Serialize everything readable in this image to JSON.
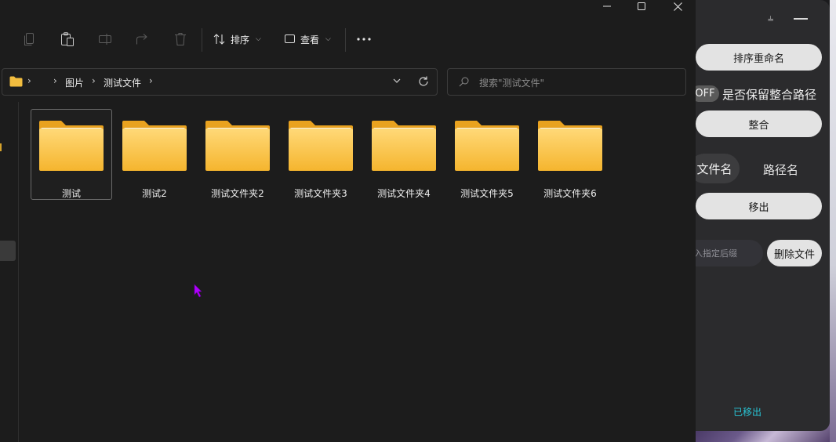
{
  "window": {
    "minimize_icon": "minimize-icon",
    "maximize_icon": "maximize-icon",
    "close_icon": "close-icon"
  },
  "toolbar": {
    "icons": [
      "copy-icon",
      "paste-icon",
      "rename-icon",
      "share-icon",
      "delete-icon"
    ],
    "sort_label": "排序",
    "view_label": "查看",
    "more_icon": "more-icon"
  },
  "address": {
    "crumbs": [
      "图片",
      "测试文件"
    ]
  },
  "search": {
    "placeholder": "搜索\"测试文件\""
  },
  "folders": [
    {
      "name": "测试",
      "selected": true
    },
    {
      "name": "测试2",
      "selected": false
    },
    {
      "name": "测试文件夹2",
      "selected": false
    },
    {
      "name": "测试文件夹3",
      "selected": false
    },
    {
      "name": "测试文件夹4",
      "selected": false
    },
    {
      "name": "测试文件夹5",
      "selected": false
    },
    {
      "name": "测试文件夹6",
      "selected": false
    }
  ],
  "panel": {
    "sort_rename_label": "排序重命名",
    "toggle_label": "OFF",
    "keep_path_label": "是否保留整合路径",
    "merge_label": "整合",
    "seg_filename": "文件名",
    "seg_pathname": "路径名",
    "move_out_label": "移出",
    "suffix_placeholder": "入指定后缀",
    "delete_file_label": "删除文件",
    "status_text": "已移出"
  },
  "colors": {
    "accent_status": "#29c6d6",
    "folder_yellow": "#f7c64a",
    "cursor": "#b000ff"
  }
}
